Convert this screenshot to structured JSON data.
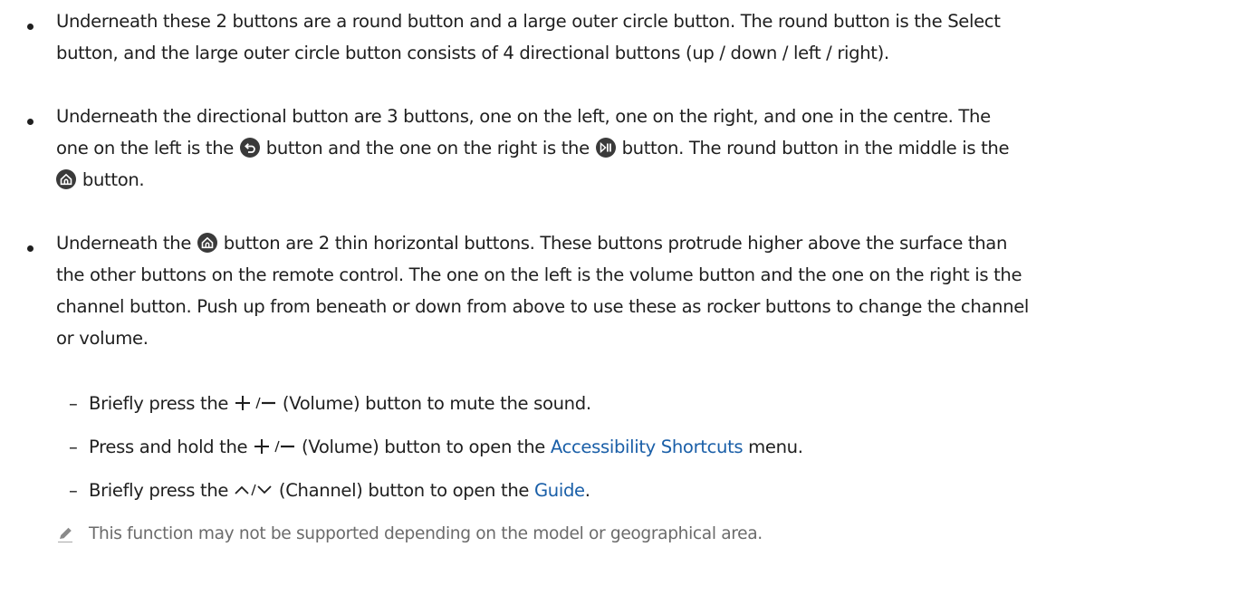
{
  "bullets": [
    {
      "lines": [
        "Underneath these 2 buttons are a round button and a large outer circle button. The round button is the Select",
        "button, and the large outer circle button consists of 4 directional buttons (up / down / left / right)."
      ]
    },
    {
      "line1": "Underneath the directional button are 3 buttons, one on the left, one on the right, and one in the centre. The",
      "line2_a": "one on the left is the ",
      "line2_b": " button and the one on the right is the ",
      "line2_c": " button. The round button in the middle is the",
      "line3": " button."
    },
    {
      "line1_a": "Underneath the ",
      "line1_b": " button are 2 thin horizontal buttons. These buttons protrude higher above the surface than",
      "line2": "the other buttons on the remote control. The one on the left is the volume button and the one on the right is the",
      "line3": "channel button. Push up from beneath or down from above to use these as rocker buttons to change the channel",
      "line4": "or volume."
    }
  ],
  "sub_items": [
    {
      "dash": "–",
      "a": "Briefly press the ",
      "symbol_label": "+/–",
      "b": " (Volume) button to mute the sound."
    },
    {
      "dash": "–",
      "a": "Press and hold the ",
      "symbol_label": "+/–",
      "b": " (Volume) button to open the ",
      "link": "Accessibility Shortcuts",
      "c": " menu."
    },
    {
      "dash": "–",
      "a": "Briefly press the ",
      "symbol_label": "∧/∨",
      "b": " (Channel) button to open the ",
      "link": "Guide",
      "c": "."
    }
  ],
  "note": {
    "icon": "pencil-icon",
    "text": "This function may not be supported depending on the model or geographical area."
  },
  "icons": {
    "return": "return-icon",
    "play_pause": "play-pause-icon",
    "home": "home-icon"
  },
  "colors": {
    "text": "#1f1f1f",
    "link": "#1a5fa8",
    "note": "#6b6b6b",
    "icon": "#3a3a3a"
  }
}
